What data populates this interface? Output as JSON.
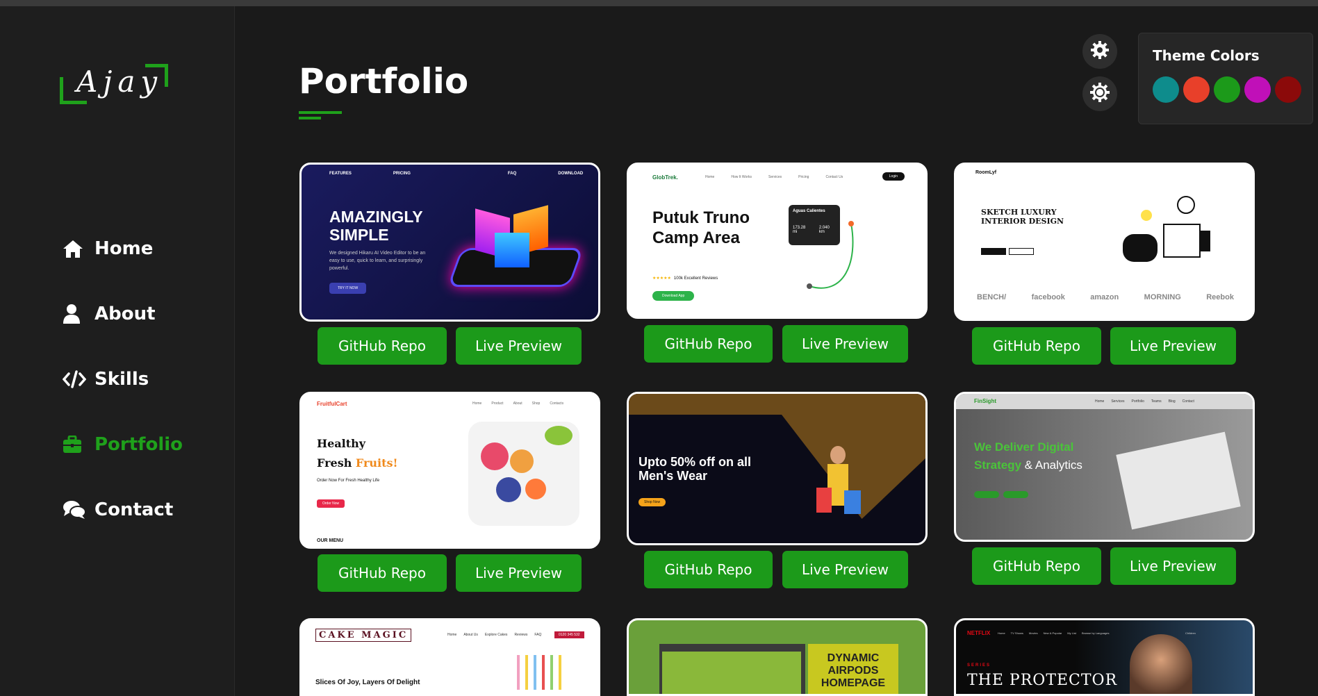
{
  "brand": {
    "logo_text": "Ajay"
  },
  "nav": {
    "items": [
      {
        "label": "Home",
        "icon": "home-icon"
      },
      {
        "label": "About",
        "icon": "user-icon"
      },
      {
        "label": "Skills",
        "icon": "code-icon"
      },
      {
        "label": "Portfolio",
        "icon": "briefcase-icon",
        "active": true
      },
      {
        "label": "Contact",
        "icon": "chat-icon"
      }
    ]
  },
  "page": {
    "title": "Portfolio"
  },
  "theme": {
    "title": "Theme Colors",
    "colors": [
      "#0e8c8c",
      "#e8402a",
      "#1c9a1a",
      "#c010b8",
      "#8b0a0a"
    ],
    "accent": "#1fa11b"
  },
  "buttons": {
    "github": "GitHub Repo",
    "live": "Live Preview"
  },
  "projects": [
    {
      "name": "AMAZINGLY SIMPLE",
      "sub": "We designed Hikaru AI Video Editor to be an easy to use, quick to learn, and surprisingly powerful.",
      "nav": [
        "FEATURES",
        "PRICING",
        "FAQ",
        "DOWNLOAD"
      ],
      "cta": "TRY IT NOW"
    },
    {
      "name": "Putuk Truno Camp Area",
      "brand": "GlobTrek.",
      "nav": [
        "Home",
        "How It Works",
        "Services",
        "Pricing",
        "Contact Us"
      ],
      "badge": "100k Excellent Reviews",
      "panel_title": "Aguas Calientes",
      "stat1": "173.28 mi",
      "stat2": "2.040 km",
      "cta": "Download App",
      "login": "Login"
    },
    {
      "name": "SKETCH LUXURY INTERIOR DESIGN",
      "brand": "RoomLyf",
      "logos": [
        "BENCH/",
        "facebook",
        "amazon",
        "MORNING",
        "Reebok"
      ]
    },
    {
      "name": "Healthy Fresh Fruits!",
      "line1": "Healthy",
      "line2a": "Fresh",
      "line2b": "Fruits!",
      "brand": "FruitfulCart",
      "tag": "Order Now For Fresh Healthy Life",
      "cta": "Order Now",
      "footer": "OUR MENU",
      "nav": [
        "Home",
        "Product",
        "About",
        "Shop",
        "Contacts"
      ]
    },
    {
      "name": "Upto 50% off on all Men's Wear",
      "cta": "Shop Now"
    },
    {
      "name": "We Deliver Digital Strategy & Analytics",
      "brand": "FinSight",
      "h1": "We Deliver Digital",
      "h2a": "Strategy",
      "h2b": "& Analytics",
      "nav": [
        "Home",
        "Services",
        "Portfolio",
        "Teams",
        "Blog",
        "Contact"
      ]
    },
    {
      "name": "CAKE MAGIC",
      "sub": "Slices Of Joy, Layers Of Delight",
      "nav": [
        "Home",
        "About Us",
        "Explore Cakes",
        "Reviews",
        "FAQ"
      ],
      "phone": "0120 345 532"
    },
    {
      "name": "DYNAMIC AIRPODS HOMEPAGE"
    },
    {
      "name": "THE PROTECTOR",
      "brand": "NETFLIX",
      "series": "SERIES",
      "nav": [
        "Home",
        "TV Shows",
        "Movies",
        "New & Popular",
        "My List",
        "Browse by Languages"
      ],
      "kids": "Children"
    }
  ]
}
